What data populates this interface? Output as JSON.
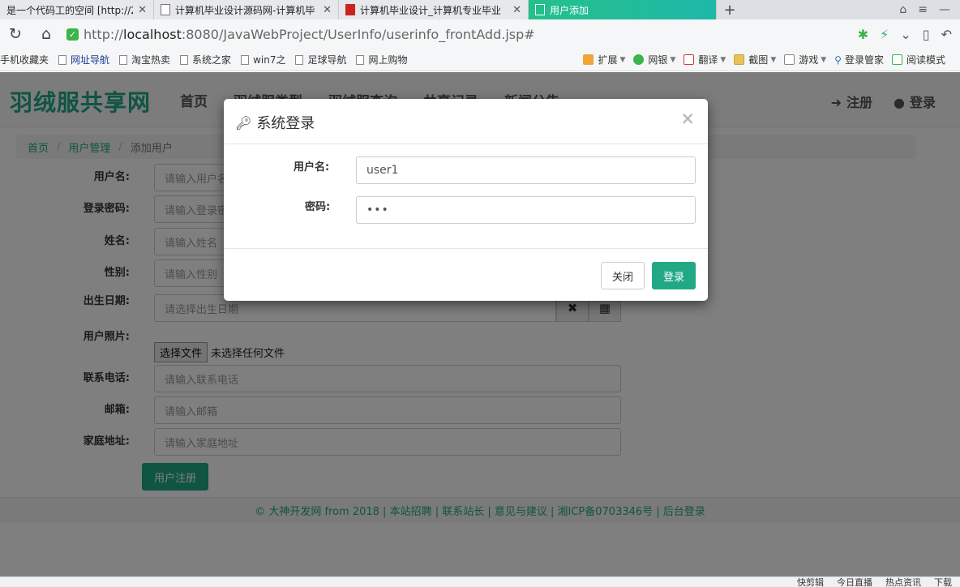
{
  "browser": {
    "tabs": [
      {
        "label": "是一个代码工的空间 [http://2"
      },
      {
        "label": "计算机毕业设计源码网-计算机毕"
      },
      {
        "label": "计算机毕业设计_计算机专业毕业"
      },
      {
        "label": "用户添加"
      }
    ],
    "url_scheme": "http://",
    "url_host": "localhost",
    "url_path": ":8080/JavaWebProject/UserInfo/userinfo_frontAdd.jsp#",
    "bookmarks": [
      "手机收藏夹",
      "网址导航",
      "淘宝热卖",
      "系统之家",
      "win7之",
      "足球导航",
      "网上购物"
    ],
    "bookmarks_right": [
      "扩展",
      "网银",
      "翻译",
      "截图",
      "游戏",
      "登录管家",
      "阅读模式"
    ]
  },
  "site": {
    "brand": "羽绒服共享网",
    "nav": [
      "首页",
      "羽绒服类型",
      "羽绒服查询",
      "共享记录",
      "新闻公告"
    ],
    "register": "注册",
    "login": "登录"
  },
  "breadcrumb": {
    "home": "首页",
    "section": "用户管理",
    "current": "添加用户"
  },
  "form": {
    "username": {
      "label": "用户名:",
      "placeholder": "请输入用户名"
    },
    "password": {
      "label": "登录密码:",
      "placeholder": "请输入登录密码"
    },
    "name": {
      "label": "姓名:",
      "placeholder": "请输入姓名"
    },
    "gender": {
      "label": "性别:",
      "placeholder": "请输入性别"
    },
    "birth": {
      "label": "出生日期:",
      "placeholder": "请选择出生日期"
    },
    "photo": {
      "label": "用户照片:",
      "button": "选择文件",
      "status": "未选择任何文件"
    },
    "phone": {
      "label": "联系电话:",
      "placeholder": "请输入联系电话"
    },
    "email": {
      "label": "邮箱:",
      "placeholder": "请输入邮箱"
    },
    "address": {
      "label": "家庭地址:",
      "placeholder": "请输入家庭地址"
    },
    "submit": "用户注册"
  },
  "footer": {
    "text": "© 大神开发网 from 2018 | 本站招聘 | 联系站长 | 意见与建议 | 湘ICP备0703346号 | 后台登录"
  },
  "modal": {
    "title": "系统登录",
    "username_label": "用户名:",
    "username_value": "user1",
    "password_label": "密码:",
    "password_value": "•••",
    "close_button": "关闭",
    "login_button": "登录"
  },
  "statusbar": [
    "快剪辑",
    "今日直播",
    "热点资讯",
    "下载"
  ]
}
